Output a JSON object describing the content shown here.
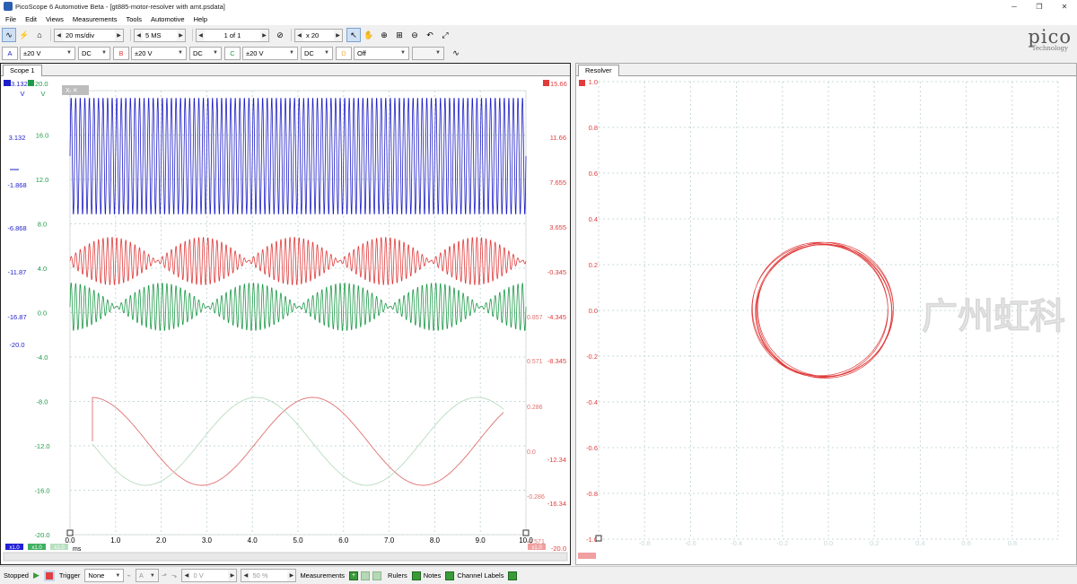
{
  "window": {
    "title": "PicoScope 6 Automotive Beta - [gt885-motor-resolver with amt.psdata]"
  },
  "menu": [
    "File",
    "Edit",
    "Views",
    "Measurements",
    "Tools",
    "Automotive",
    "Help"
  ],
  "toolbar": {
    "timebase": "20 ms/div",
    "samples": "5 MS",
    "capture": "1 of 1",
    "zoom": "x 20"
  },
  "channels": [
    {
      "id": "A",
      "range": "±20 V",
      "coupling": "DC",
      "color": "#1e1ec8"
    },
    {
      "id": "B",
      "range": "±20 V",
      "coupling": "DC",
      "color": "#e03c3c"
    },
    {
      "id": "C",
      "range": "±20 V",
      "coupling": "DC",
      "color": "#1f9a4a"
    },
    {
      "id": "D",
      "range": "Off",
      "coupling": "",
      "color": "#e8b040"
    }
  ],
  "logo": {
    "name": "pico",
    "sub": "Technology"
  },
  "scope": {
    "tab": "Scope 1",
    "axisA": {
      "top": "3.132",
      "labels": [
        "3.132",
        "-1.868",
        "-6.868",
        "-11.87",
        "-16.87",
        "-20.0"
      ],
      "unit": "V"
    },
    "axisC": {
      "top": "20.0",
      "labels": [
        "16.0",
        "12.0",
        "8.0",
        "4.0",
        "0.0",
        "-4.0",
        "-8.0",
        "-12.0",
        "-16.0",
        "-20.0"
      ],
      "unit": "V"
    },
    "axisB": {
      "top": "15.66",
      "labels": [
        "11.66",
        "7.655",
        "3.655",
        "-0.345",
        "-4.345",
        "-8.345",
        "-12.34",
        "-16.34",
        "-20.0"
      ]
    },
    "axisMath": {
      "labels": [
        "0.857",
        "0.571",
        "0.286",
        "0.0",
        "-0.286",
        "-0.571"
      ]
    },
    "time": {
      "labels": [
        "0.0",
        "1.0",
        "2.0",
        "3.0",
        "4.0",
        "5.0",
        "6.0",
        "7.0",
        "8.0",
        "9.0",
        "10.0"
      ],
      "unit": "ms"
    },
    "tags": [
      "x1.0",
      "x1.0",
      "x1.0",
      "x1.0"
    ]
  },
  "resolver": {
    "tab": "Resolver",
    "yLabels": [
      "1.0",
      "0.8",
      "0.6",
      "0.4",
      "0.2",
      "0.0",
      "-0.2",
      "-0.4",
      "-0.6",
      "-0.8",
      "-1.0"
    ],
    "xLabels": [
      "-0.8",
      "-0.6",
      "-0.4",
      "-0.2",
      "0.0",
      "0.2",
      "0.4",
      "0.6",
      "0.8"
    ],
    "watermark": "广州虹科"
  },
  "status": {
    "state": "Stopped",
    "trigger_label": "Trigger",
    "trigger_mode": "None",
    "trig_channel": "A",
    "trig_level": "0 V",
    "trig_pct": "50 %",
    "measurements": "Measurements",
    "rulers": "Rulers",
    "notes": "Notes",
    "channel_labels": "Channel Labels"
  }
}
